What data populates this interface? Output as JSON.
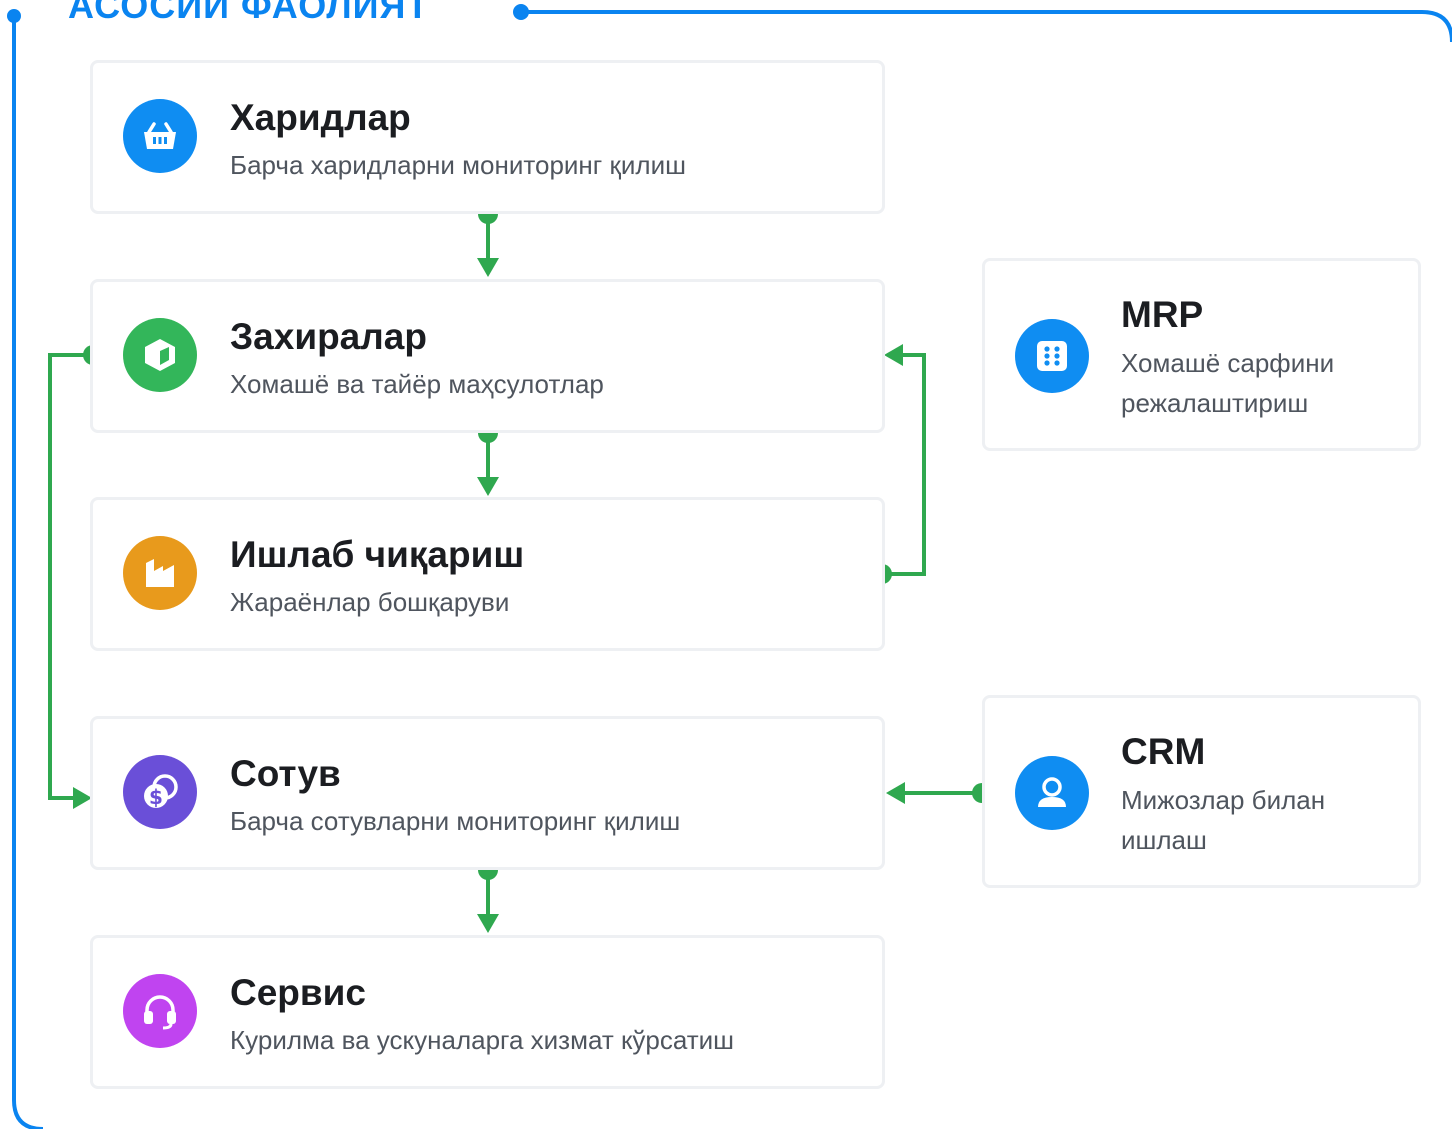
{
  "section": {
    "title": "АСОСИЙ ФАОЛИЯТ"
  },
  "colors": {
    "frame": "#0a84f0",
    "connector": "#2fa84f",
    "icon_purchases": "#0f8df2",
    "icon_stock": "#33b65a",
    "icon_production": "#e89a1c",
    "icon_sales": "#6a4fd8",
    "icon_service": "#c044f0",
    "icon_mrp": "#0f8df2",
    "icon_crm": "#0f8df2"
  },
  "modules": [
    {
      "title": "Харидлар",
      "subtitle": "Барча харидларни мониторинг қилиш",
      "icon": "basket-icon"
    },
    {
      "title": "Захиралар",
      "subtitle": "Хомашё ва тайёр маҳсулотлар",
      "icon": "box-icon"
    },
    {
      "title": "Ишлаб чиқариш",
      "subtitle": "Жараёнлар бошқаруви",
      "icon": "factory-icon"
    },
    {
      "title": "Сотув",
      "subtitle": "Барча сотувларни мониторинг қилиш",
      "icon": "coins-icon"
    },
    {
      "title": "Сервис",
      "subtitle": "Курилма ва ускуналарга хизмат кўрсатиш",
      "icon": "headset-icon"
    }
  ],
  "side_modules": [
    {
      "title": "MRP",
      "subtitle": "Хомашё сарфини режалаштириш",
      "icon": "grid-dots-icon"
    },
    {
      "title": "CRM",
      "subtitle": "Мижозлар билан ишлаш",
      "icon": "user-icon"
    }
  ]
}
